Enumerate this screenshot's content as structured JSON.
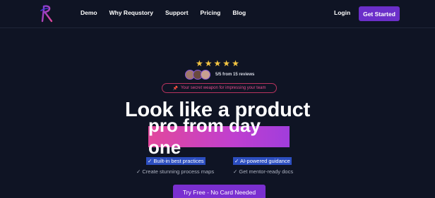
{
  "nav": {
    "links": [
      "Demo",
      "Why Requstory",
      "Support",
      "Pricing",
      "Blog"
    ],
    "login": "Login",
    "get_started": "Get Started"
  },
  "hero": {
    "rating_stars": 5,
    "reviews": "5/5 from 15 reviews",
    "tagline": "Your secret weapon for impressing your team",
    "headline": "Look like a product",
    "highlight": "pro from day one",
    "features": {
      "left_highlight": "✓ Built-in best practices",
      "left_sub": "✓ Create stunning process maps",
      "right_highlight": "✓ AI-powered guidance",
      "right_sub": "✓ Get mentor-ready docs"
    },
    "cta": "Try Free - No Card Needed"
  },
  "colors": {
    "background": "#0f1424",
    "accent_purple": "#6b2fc9",
    "star": "#f4c542",
    "highlight_blue": "#2c4ec0",
    "pill_border": "#b8335e"
  },
  "icons": [
    "logo-icon",
    "star-icon",
    "pin-icon",
    "check-icon"
  ]
}
